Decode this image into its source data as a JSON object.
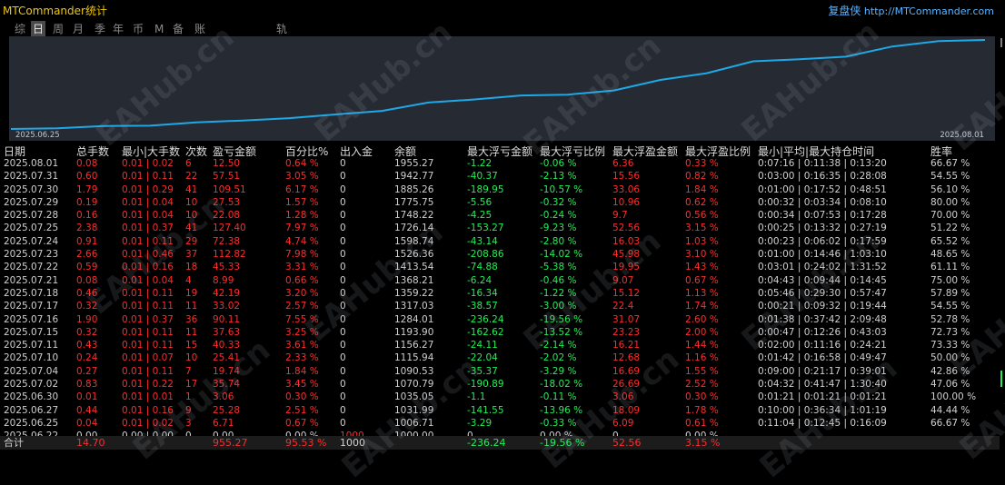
{
  "app": {
    "title": "MTCommander统计",
    "brand_cn": "复盘侠",
    "brand_url": "http://MTCommander.com",
    "watermark": "EAHub.cn"
  },
  "tabs": [
    {
      "label": "综",
      "active": false
    },
    {
      "label": "日",
      "active": true
    },
    {
      "label": "周",
      "active": false
    },
    {
      "label": "月",
      "active": false
    },
    {
      "label": "季",
      "active": false
    },
    {
      "label": "年",
      "active": false
    },
    {
      "label": "币",
      "active": false
    },
    {
      "label": "M",
      "active": false
    },
    {
      "label": "备",
      "active": false
    },
    {
      "label": "账户",
      "active": false
    },
    {
      "label": "轨迹",
      "active": false
    }
  ],
  "chart_data": {
    "type": "line",
    "x_start_label": "2025.06.25",
    "x_end_label": "2025.08.01",
    "x": [
      "2025.06.22",
      "2025.06.25",
      "2025.06.27",
      "2025.06.30",
      "2025.07.02",
      "2025.07.04",
      "2025.07.10",
      "2025.07.11",
      "2025.07.15",
      "2025.07.16",
      "2025.07.17",
      "2025.07.18",
      "2025.07.21",
      "2025.07.22",
      "2025.07.23",
      "2025.07.24",
      "2025.07.25",
      "2025.07.28",
      "2025.07.29",
      "2025.07.30",
      "2025.07.31",
      "2025.08.01"
    ],
    "values": [
      1000.0,
      1006.71,
      1031.99,
      1035.05,
      1070.79,
      1090.53,
      1115.94,
      1156.27,
      1193.9,
      1284.01,
      1317.03,
      1359.22,
      1368.21,
      1413.54,
      1526.36,
      1598.74,
      1726.14,
      1748.22,
      1775.75,
      1885.26,
      1942.77,
      1955.27
    ],
    "line_color": "#1fa8e8",
    "grid": false
  },
  "table": {
    "headers": [
      "日期",
      "总手数",
      "最小|大手数",
      "次数",
      "盈亏金额",
      "百分比%",
      "出入金",
      "余额",
      "最大浮亏金额",
      "最大浮亏比例",
      "最大浮盈金额",
      "最大浮盈比例",
      "最小|平均|最大持仓时间",
      "胜率"
    ],
    "rows": [
      [
        "2025.08.01",
        "0.08",
        "0.01 | 0.02",
        "6",
        "12.50",
        "0.64 %",
        "0",
        "1955.27",
        "-1.22",
        "-0.06 %",
        "6.36",
        "0.33 %",
        "0:07:16 | 0:11:38 | 0:13:20",
        "66.67 %"
      ],
      [
        "2025.07.31",
        "0.60",
        "0.01 | 0.11",
        "22",
        "57.51",
        "3.05 %",
        "0",
        "1942.77",
        "-40.37",
        "-2.13 %",
        "15.56",
        "0.82 %",
        "0:03:00 | 0:16:35 | 0:28:08",
        "54.55 %"
      ],
      [
        "2025.07.30",
        "1.79",
        "0.01 | 0.29",
        "41",
        "109.51",
        "6.17 %",
        "0",
        "1885.26",
        "-189.95",
        "-10.57 %",
        "33.06",
        "1.84 %",
        "0:01:00 | 0:17:52 | 0:48:51",
        "56.10 %"
      ],
      [
        "2025.07.29",
        "0.19",
        "0.01 | 0.04",
        "10",
        "27.53",
        "1.57 %",
        "0",
        "1775.75",
        "-5.56",
        "-0.32 %",
        "10.96",
        "0.62 %",
        "0:00:32 | 0:03:34 | 0:08:10",
        "80.00 %"
      ],
      [
        "2025.07.28",
        "0.16",
        "0.01 | 0.04",
        "10",
        "22.08",
        "1.28 %",
        "0",
        "1748.22",
        "-4.25",
        "-0.24 %",
        "9.7",
        "0.56 %",
        "0:00:34 | 0:07:53 | 0:17:28",
        "70.00 %"
      ],
      [
        "2025.07.25",
        "2.38",
        "0.01 | 0.37",
        "41",
        "127.40",
        "7.97 %",
        "0",
        "1726.14",
        "-153.27",
        "-9.23 %",
        "52.56",
        "3.15 %",
        "0:00:25 | 0:13:32 | 0:27:19",
        "51.22 %"
      ],
      [
        "2025.07.24",
        "0.91",
        "0.01 | 0.11",
        "29",
        "72.38",
        "4.74 %",
        "0",
        "1598.74",
        "-43.14",
        "-2.80 %",
        "16.03",
        "1.03 %",
        "0:00:23 | 0:06:02 | 0:17:59",
        "65.52 %"
      ],
      [
        "2025.07.23",
        "2.66",
        "0.01 | 0.46",
        "37",
        "112.82",
        "7.98 %",
        "0",
        "1526.36",
        "-208.86",
        "-14.02 %",
        "45.98",
        "3.10 %",
        "0:01:00 | 0:14:46 | 1:03:10",
        "48.65 %"
      ],
      [
        "2025.07.22",
        "0.59",
        "0.01 | 0.16",
        "18",
        "45.33",
        "3.31 %",
        "0",
        "1413.54",
        "-74.88",
        "-5.38 %",
        "19.95",
        "1.43 %",
        "0:03:01 | 0:24:02 | 1:31:52",
        "61.11 %"
      ],
      [
        "2025.07.21",
        "0.08",
        "0.01 | 0.04",
        "4",
        "8.99",
        "0.66 %",
        "0",
        "1368.21",
        "-6.24",
        "-0.46 %",
        "9.07",
        "0.67 %",
        "0:04:43 | 0:09:44 | 0:14:45",
        "75.00 %"
      ],
      [
        "2025.07.18",
        "0.46",
        "0.01 | 0.11",
        "19",
        "42.19",
        "3.20 %",
        "0",
        "1359.22",
        "-16.34",
        "-1.22 %",
        "15.12",
        "1.13 %",
        "0:05:46 | 0:29:30 | 0:57:47",
        "57.89 %"
      ],
      [
        "2025.07.17",
        "0.32",
        "0.01 | 0.11",
        "11",
        "33.02",
        "2.57 %",
        "0",
        "1317.03",
        "-38.57",
        "-3.00 %",
        "22.4",
        "1.74 %",
        "0:00:21 | 0:09:32 | 0:19:44",
        "54.55 %"
      ],
      [
        "2025.07.16",
        "1.90",
        "0.01 | 0.37",
        "36",
        "90.11",
        "7.55 %",
        "0",
        "1284.01",
        "-236.24",
        "-19.56 %",
        "31.07",
        "2.60 %",
        "0:01:38 | 0:37:42 | 2:09:48",
        "52.78 %"
      ],
      [
        "2025.07.15",
        "0.32",
        "0.01 | 0.11",
        "11",
        "37.63",
        "3.25 %",
        "0",
        "1193.90",
        "-162.62",
        "-13.52 %",
        "23.23",
        "2.00 %",
        "0:00:47 | 0:12:26 | 0:43:03",
        "72.73 %"
      ],
      [
        "2025.07.11",
        "0.43",
        "0.01 | 0.11",
        "15",
        "40.33",
        "3.61 %",
        "0",
        "1156.27",
        "-24.11",
        "-2.14 %",
        "16.21",
        "1.44 %",
        "0:02:00 | 0:11:16 | 0:24:21",
        "73.33 %"
      ],
      [
        "2025.07.10",
        "0.24",
        "0.01 | 0.07",
        "10",
        "25.41",
        "2.33 %",
        "0",
        "1115.94",
        "-22.04",
        "-2.02 %",
        "12.68",
        "1.16 %",
        "0:01:42 | 0:16:58 | 0:49:47",
        "50.00 %"
      ],
      [
        "2025.07.04",
        "0.27",
        "0.01 | 0.11",
        "7",
        "19.74",
        "1.84 %",
        "0",
        "1090.53",
        "-35.37",
        "-3.29 %",
        "16.69",
        "1.55 %",
        "0:09:00 | 0:21:17 | 0:39:01",
        "42.86 %"
      ],
      [
        "2025.07.02",
        "0.83",
        "0.01 | 0.22",
        "17",
        "35.74",
        "3.45 %",
        "0",
        "1070.79",
        "-190.89",
        "-18.02 %",
        "26.69",
        "2.52 %",
        "0:04:32 | 0:41:47 | 1:30:40",
        "47.06 %"
      ],
      [
        "2025.06.30",
        "0.01",
        "0.01 | 0.01",
        "1",
        "3.06",
        "0.30 %",
        "0",
        "1035.05",
        "-1.1",
        "-0.11 %",
        "3.06",
        "0.30 %",
        "0:01:21 | 0:01:21 | 0:01:21",
        "100.00 %"
      ],
      [
        "2025.06.27",
        "0.44",
        "0.01 | 0.16",
        "9",
        "25.28",
        "2.51 %",
        "0",
        "1031.99",
        "-141.55",
        "-13.96 %",
        "18.09",
        "1.78 %",
        "0:10:00 | 0:36:34 | 1:01:19",
        "44.44 %"
      ],
      [
        "2025.06.25",
        "0.04",
        "0.01 | 0.02",
        "3",
        "6.71",
        "0.67 %",
        "0",
        "1006.71",
        "-3.29",
        "-0.33 %",
        "6.09",
        "0.61 %",
        "0:11:04 | 0:12:45 | 0:16:09",
        "66.67 %"
      ],
      [
        "2025.06.22",
        "0.00",
        "0.00 | 0.00",
        "0",
        "0.00",
        "0.00 %",
        "1000",
        "1000.00",
        "0",
        "0.00 %",
        "0",
        "0.00 %",
        "",
        ""
      ]
    ],
    "total": [
      "合计",
      "14.70",
      "",
      "",
      "955.27",
      "95.53 %",
      "1000",
      "",
      "-236.24",
      "-19.56 %",
      "52.56",
      "3.15 %",
      "",
      ""
    ]
  }
}
